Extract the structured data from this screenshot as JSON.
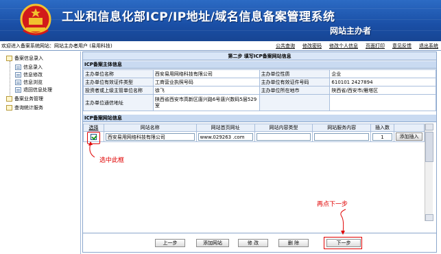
{
  "header": {
    "title": "工业和信息化部ICP/IP地址/域名信息备案管理系统",
    "subtitle": "网站主办者",
    "colors": {
      "banner": "#1a4fa6",
      "accent_red": "#e00000"
    }
  },
  "topbar": {
    "welcome": "欢迎进入备案系统网站：网站主办者用户 (易用科技)",
    "nav": [
      "公共查询",
      "修改密码",
      "修改个人信息",
      "页面打印",
      "意见反馈",
      "退出系统"
    ]
  },
  "sidebar": {
    "items": [
      {
        "label": "备案信息录入",
        "level": 0
      },
      {
        "label": "信息录入",
        "level": 1
      },
      {
        "label": "信息修改",
        "level": 1
      },
      {
        "label": "信息浏览",
        "level": 1
      },
      {
        "label": "退回信息处理",
        "level": 1
      },
      {
        "label": "备案业务管理",
        "level": 0
      },
      {
        "label": "查询统计服务",
        "level": 0
      }
    ]
  },
  "main": {
    "step_title": "第二步 填写ICP备案网站信息",
    "entity_section": "ICP备案主体信息",
    "entity_rows": [
      {
        "l1": "主办单位名称",
        "v1": "西安易用网络科技有限公司",
        "l2": "主办单位性质",
        "v2": "企业"
      },
      {
        "l1": "主办单位有效证件类型",
        "v1": "工商营业执照号码",
        "l2": "主办单位有效证件号码",
        "v2": "610101 2427894"
      },
      {
        "l1": "投资者或上级主管单位名称",
        "v1": "徐飞",
        "l2": "主办单位所在地市",
        "v2": "陕西省/西安市/雁塔区"
      },
      {
        "l1": "主办单位通信地址",
        "v1": "陕西省西安市高新区唐兴路6号唐兴数码5层529室",
        "l2": "",
        "v2": ""
      }
    ],
    "website_section": "ICP备案网站信息",
    "website_headers": [
      "选择",
      "网站名称",
      "网站首页网址",
      "网站内容类型",
      "网站服务内容",
      "插入数"
    ],
    "website_row": {
      "name": "西安易用网络科技有限公司",
      "url": "www.029263 .com",
      "content_type": "",
      "service": "",
      "insert_count": "1",
      "insert_button": "添加插入"
    }
  },
  "buttons": {
    "prev": "上一步",
    "add_site": "添加网站",
    "modify": "修 改",
    "delete": "删 除",
    "next": "下一步"
  },
  "annotations": {
    "select_box": "选中此框",
    "click_next": "再点下一步"
  }
}
